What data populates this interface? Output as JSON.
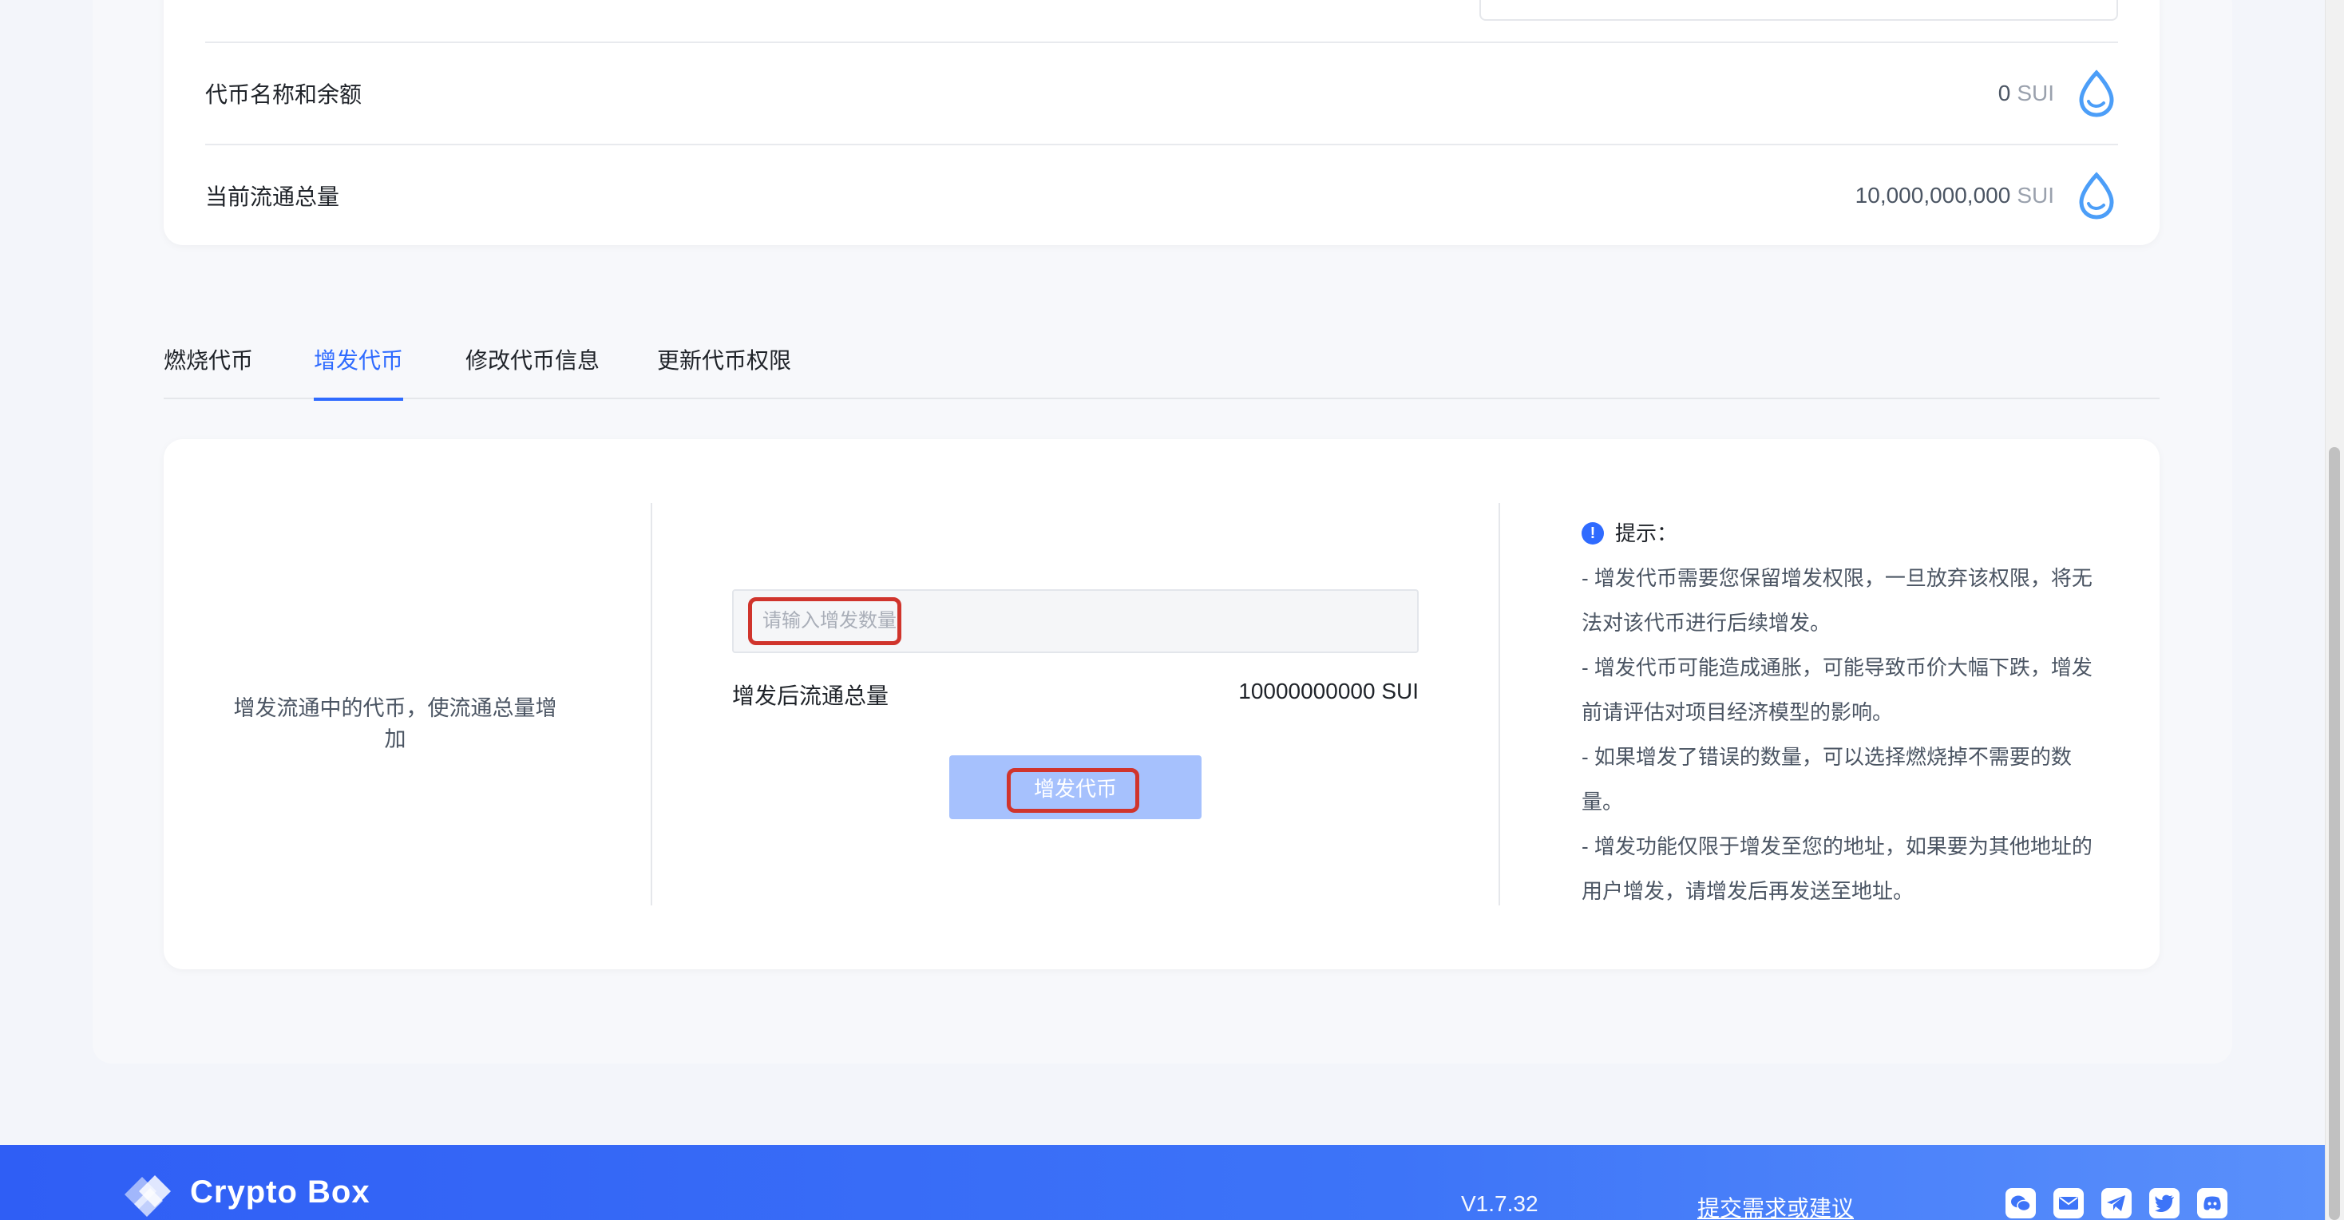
{
  "info": {
    "rows": [
      {
        "label": "代币名称和余额",
        "amount": "0",
        "unit": "SUI"
      },
      {
        "label": "当前流通总量",
        "amount": "10,000,000,000",
        "unit": "SUI"
      }
    ]
  },
  "tabs": [
    {
      "label": "燃烧代币",
      "active": false
    },
    {
      "label": "增发代币",
      "active": true
    },
    {
      "label": "修改代币信息",
      "active": false
    },
    {
      "label": "更新代币权限",
      "active": false
    }
  ],
  "mint": {
    "description": "增发流通中的代币，使流通总量增加",
    "input_placeholder": "请输入增发数量",
    "after_label": "增发后流通总量",
    "after_value": "10000000000 SUI",
    "button_label": "增发代币"
  },
  "tips": {
    "title": "提示：",
    "lines": [
      "- 增发代币需要您保留增发权限，一旦放弃该权限，将无法对该代币进行后续增发。",
      "- 增发代币可能造成通胀，可能导致币价大幅下跌，增发前请评估对项目经济模型的影响。",
      "- 如果增发了错误的数量，可以选择燃烧掉不需要的数量。",
      "- 增发功能仅限于增发至您的地址，如果要为其他地址的用户增发，请增发后再发送至地址。"
    ]
  },
  "footer": {
    "logo_text": "Crypto Box",
    "version": "V1.7.32",
    "feedback_link": "提交需求或建议",
    "social_icons": [
      "wechat-icon",
      "mail-icon",
      "telegram-icon",
      "twitter-icon",
      "discord-icon"
    ]
  },
  "colors": {
    "accent": "#2f6bff",
    "button_disabled": "#a6c1fd",
    "highlight": "#d0342c",
    "sui_drop": "#4c9ef8"
  }
}
